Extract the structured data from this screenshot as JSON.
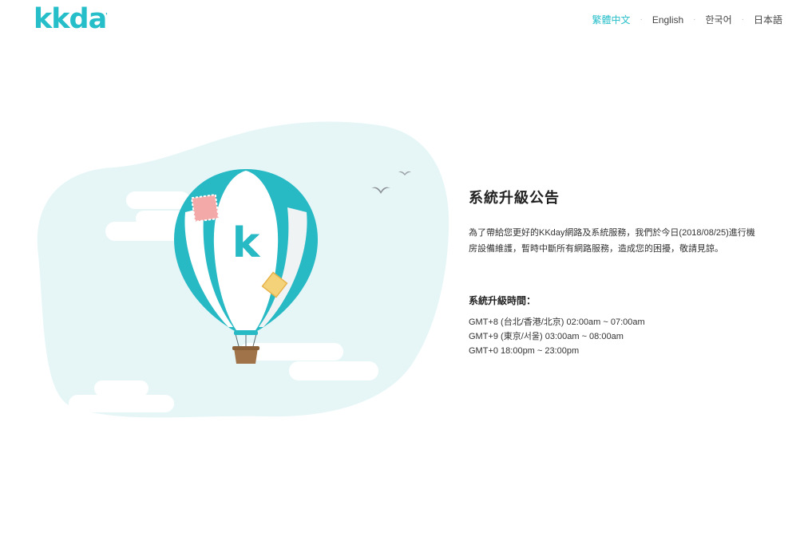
{
  "brand": {
    "logo_text": "kkday",
    "accent_color": "#26bec9"
  },
  "header": {
    "languages": [
      {
        "label": "繁體中文",
        "active": true
      },
      {
        "label": "English",
        "active": false
      },
      {
        "label": "한국어",
        "active": false
      },
      {
        "label": "日本語",
        "active": false
      }
    ],
    "separator": "·"
  },
  "illustration": {
    "balloon_letter": "k",
    "colors": {
      "blob": "#e6f6f7",
      "cloud": "#ffffff",
      "stripe": "#27b9c4",
      "stripe_light": "#ffffff",
      "patch_pink": "#f3a9a7",
      "patch_yellow": "#f4d27a",
      "basket": "#a07448",
      "bird": "#8a8f96"
    }
  },
  "notice": {
    "title": "系統升級公告",
    "body": "為了帶給您更好的KKday網路及系統服務，我們於今日(2018/08/25)進行機房設備維護，暫時中斷所有網路服務，造成您的困擾，敬請見諒。",
    "schedule_title": "系統升級時間：",
    "schedule": [
      "GMT+8 (台北/香港/北京) 02:00am ~ 07:00am",
      "GMT+9 (東京/서울) 03:00am ~ 08:00am",
      "GMT+0 18:00pm ~ 23:00pm"
    ]
  }
}
